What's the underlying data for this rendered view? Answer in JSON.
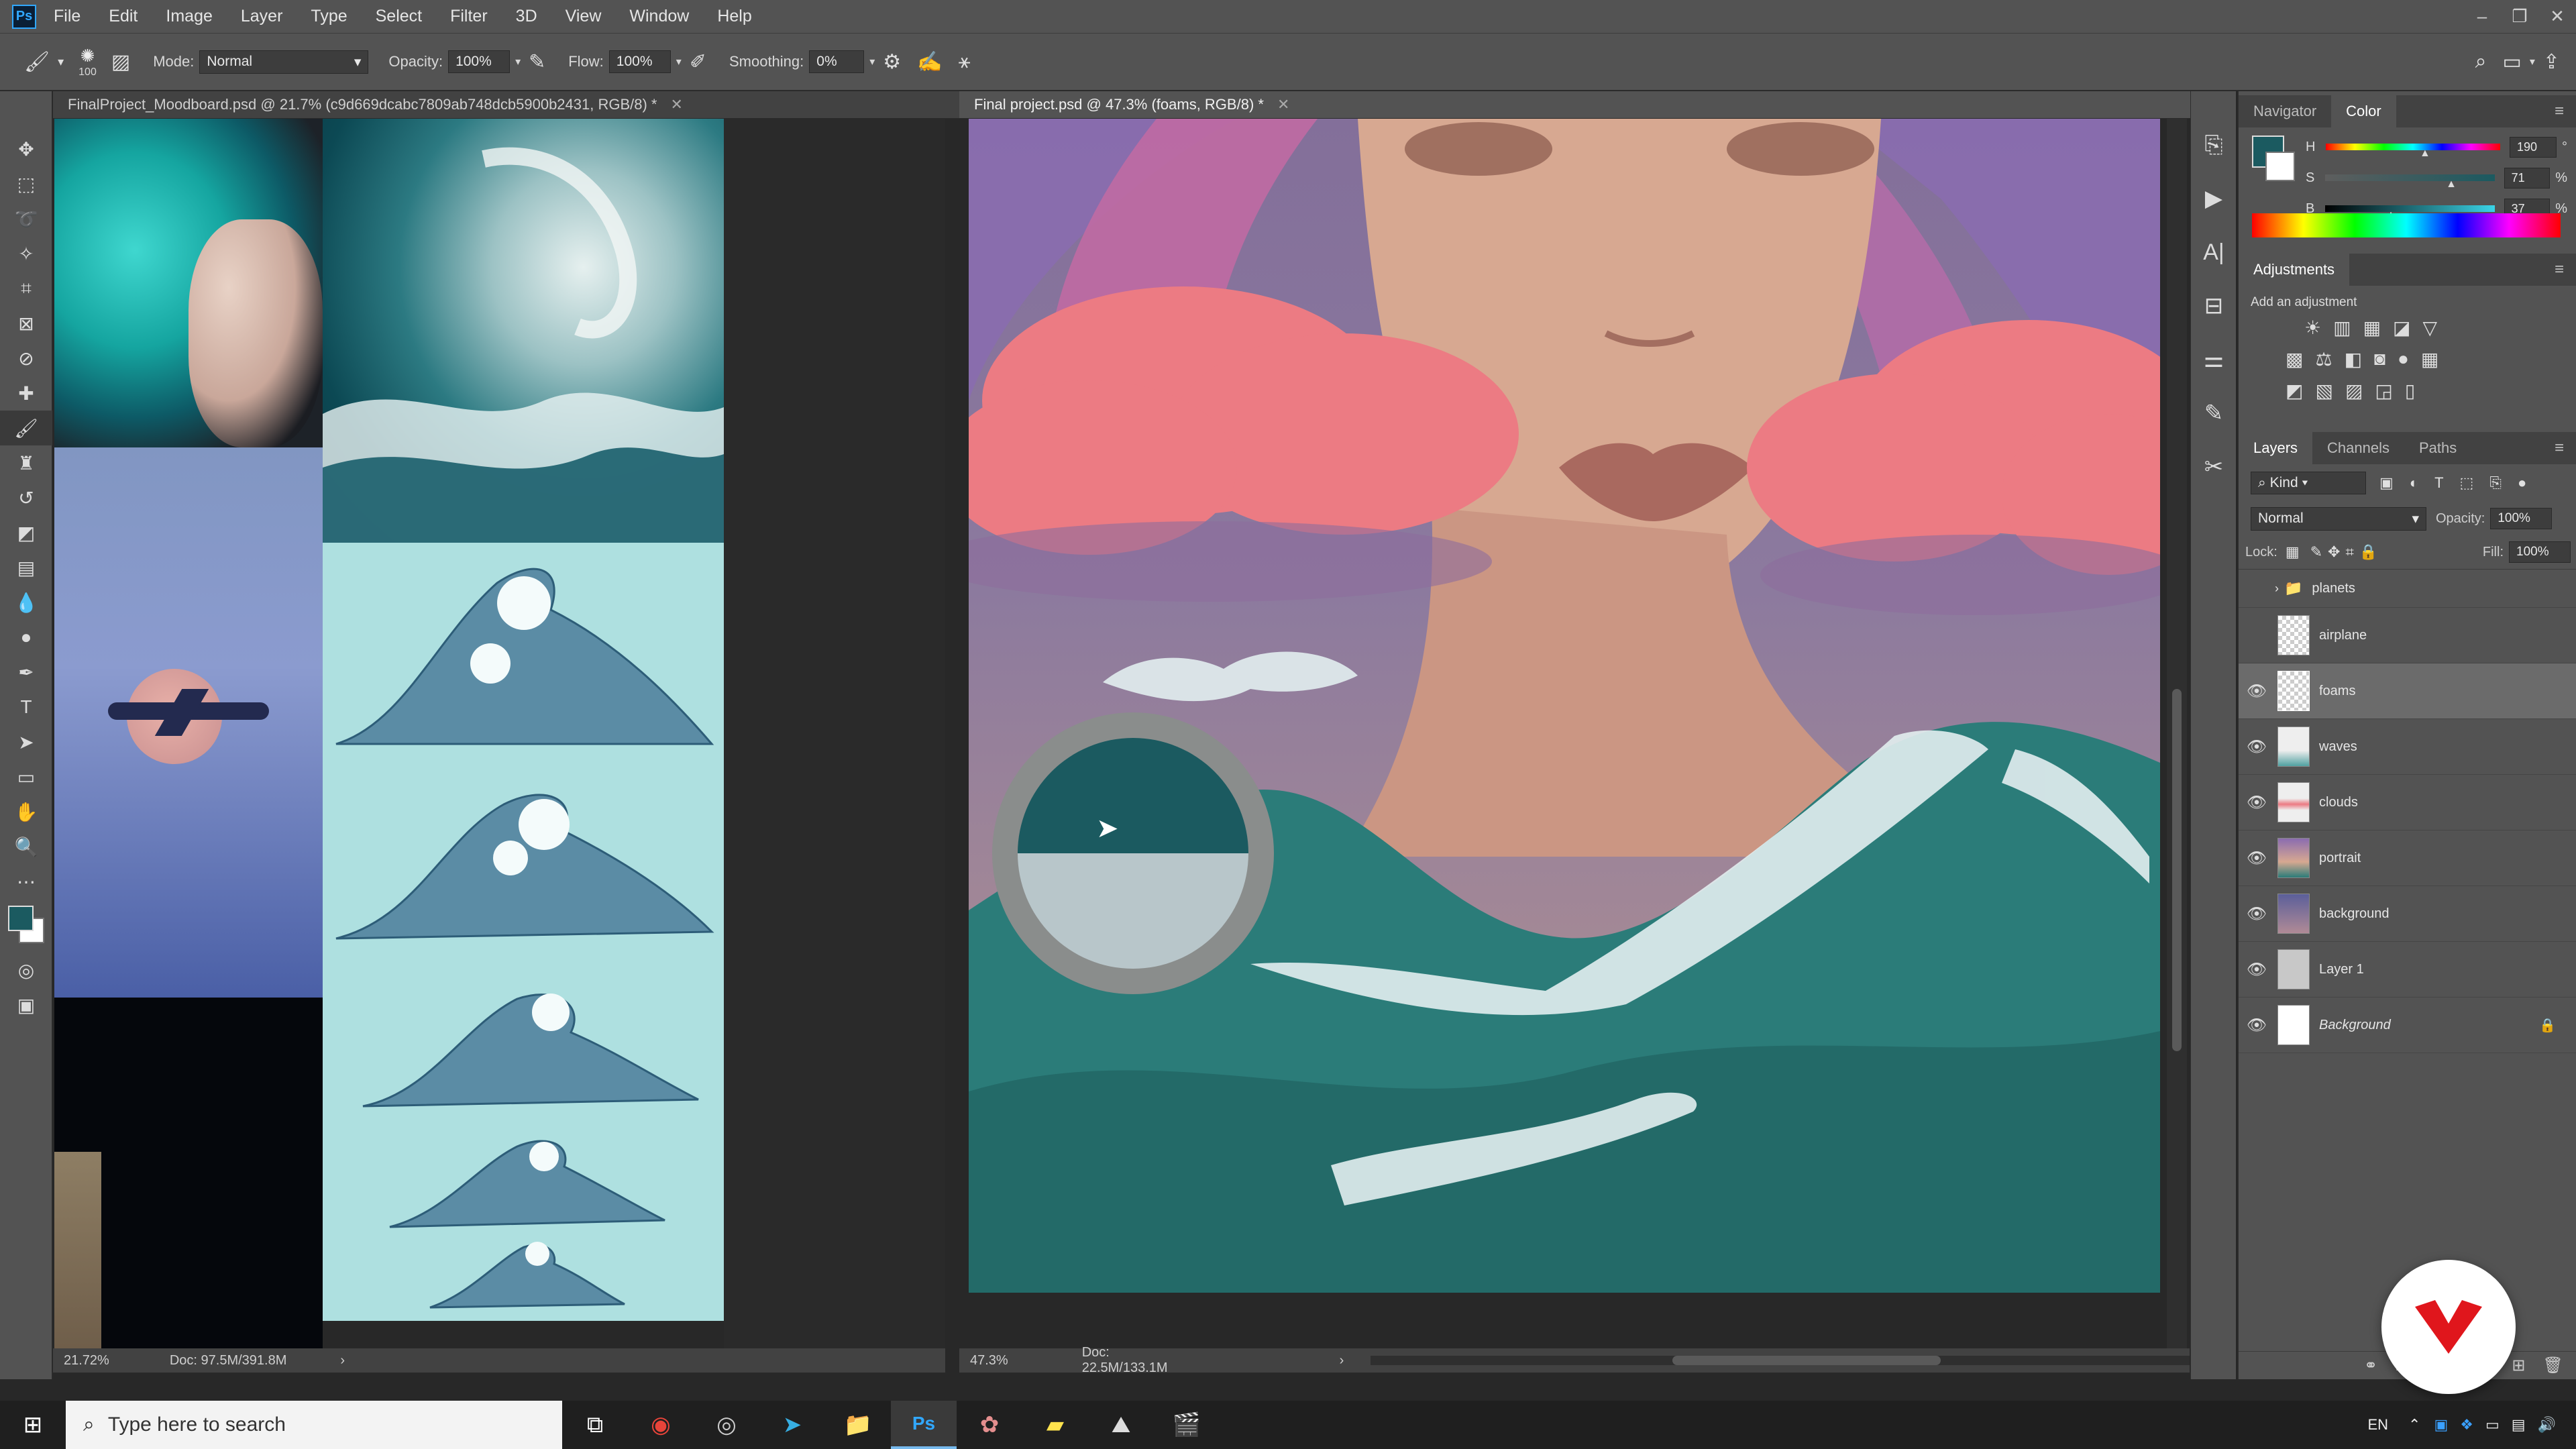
{
  "menu": {
    "app_icon": "Ps",
    "items": [
      "File",
      "Edit",
      "Image",
      "Layer",
      "Type",
      "Select",
      "Filter",
      "3D",
      "View",
      "Window",
      "Help"
    ]
  },
  "options_bar": {
    "brush_size": "100",
    "mode_label": "Mode:",
    "mode_value": "Normal",
    "opacity_label": "Opacity:",
    "opacity_value": "100%",
    "flow_label": "Flow:",
    "flow_value": "100%",
    "smoothing_label": "Smoothing:",
    "smoothing_value": "0%"
  },
  "documents": {
    "left": {
      "tab_title": "FinalProject_Moodboard.psd @ 21.7% (c9d669dcabc7809ab748dcb5900b2431, RGB/8) *",
      "zoom": "21.72%",
      "doc_size": "Doc: 97.5M/391.8M"
    },
    "right": {
      "tab_title": "Final project.psd @ 47.3% (foams, RGB/8) *",
      "zoom": "47.3%",
      "doc_size": "Doc: 22.5M/133.1M"
    }
  },
  "color_panel": {
    "tabs": [
      "Navigator",
      "Color"
    ],
    "active_tab": "Color",
    "h_label": "H",
    "h_value": "190",
    "h_unit": "°",
    "s_label": "S",
    "s_value": "71",
    "s_unit": "%",
    "b_label": "B",
    "b_value": "37",
    "b_unit": "%",
    "foreground": "#1b5a60",
    "background": "#ffffff"
  },
  "adjustments_panel": {
    "title": "Adjustments",
    "subtitle": "Add an adjustment"
  },
  "layers_panel": {
    "tabs": [
      "Layers",
      "Channels",
      "Paths"
    ],
    "active_tab": "Layers",
    "filter_value": "Kind",
    "blend_mode": "Normal",
    "opacity_label": "Opacity:",
    "opacity_value": "100%",
    "lock_label": "Lock:",
    "fill_label": "Fill:",
    "fill_value": "100%",
    "layers": [
      {
        "name": "planets",
        "visible": false,
        "group": true
      },
      {
        "name": "airplane",
        "visible": false
      },
      {
        "name": "foams",
        "visible": true,
        "selected": true
      },
      {
        "name": "waves",
        "visible": true
      },
      {
        "name": "clouds",
        "visible": true
      },
      {
        "name": "portrait",
        "visible": true
      },
      {
        "name": "background",
        "visible": true
      },
      {
        "name": "Layer 1",
        "visible": true
      },
      {
        "name": "Background",
        "visible": true,
        "locked": true
      }
    ]
  },
  "taskbar": {
    "search_placeholder": "Type here to search",
    "language": "EN"
  },
  "colors": {
    "ui_dark": "#282828",
    "ui_panel": "#535353",
    "accent_teal": "#2b7c79",
    "cloud_pink": "#ec7b83",
    "brand_red": "#e0161c"
  }
}
